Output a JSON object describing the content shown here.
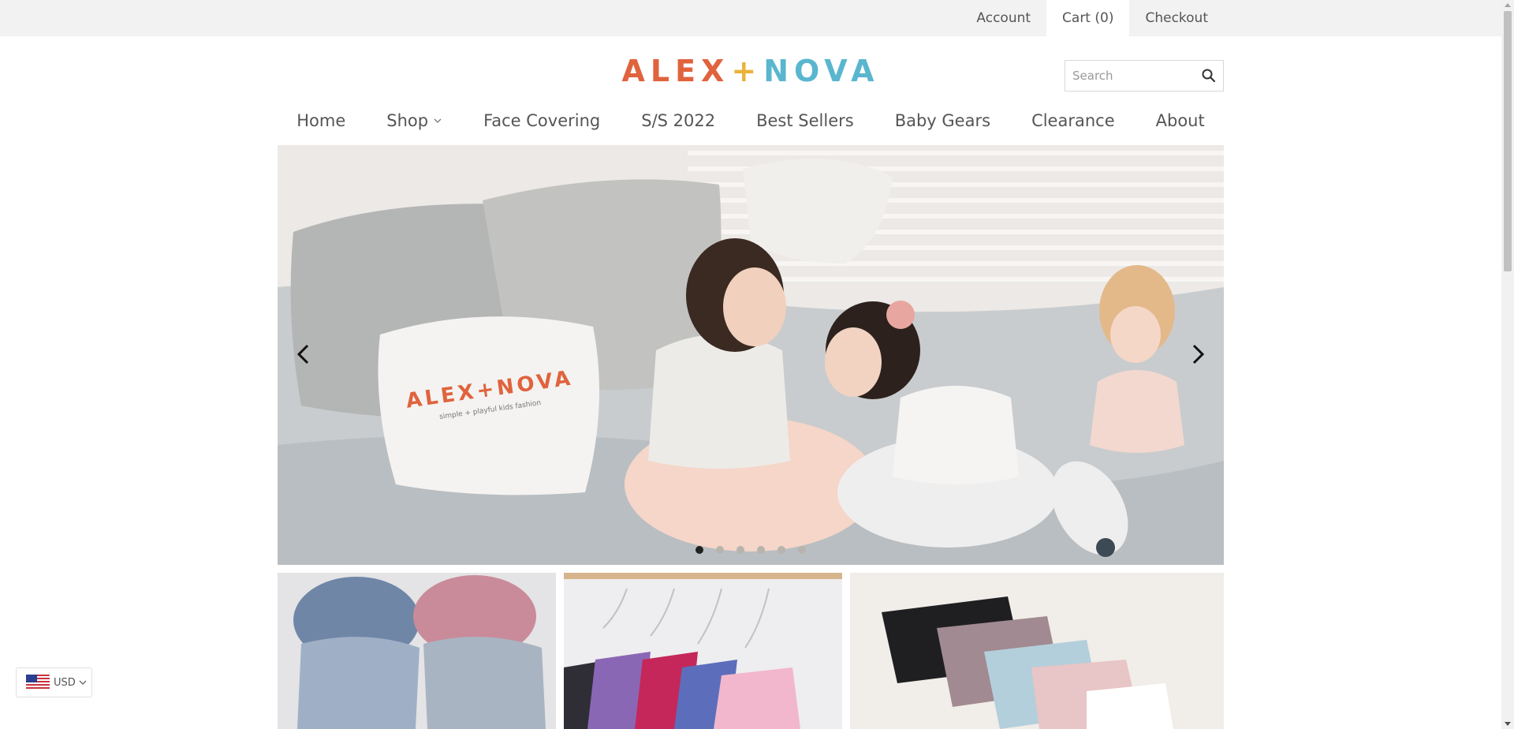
{
  "topbar": {
    "account": "Account",
    "cart": "Cart (0)",
    "checkout": "Checkout"
  },
  "logo": {
    "alex": "ALEX",
    "plus": "+",
    "nova": "NOVA"
  },
  "search": {
    "placeholder": "Search"
  },
  "nav": {
    "home": "Home",
    "shop": "Shop",
    "face_covering": "Face Covering",
    "ss2022": "S/S 2022",
    "best_sellers": "Best Sellers",
    "baby_gears": "Baby Gears",
    "clearance": "Clearance",
    "about": "About"
  },
  "hero": {
    "slide_count": 6,
    "active_slide": 1,
    "pillow_text": "ALEX+NOVA",
    "pillow_tagline": "simple + playful kids fashion"
  },
  "currency": {
    "code": "USD"
  },
  "colors": {
    "logo_orange": "#e0633d",
    "logo_yellow": "#e9b33a",
    "logo_teal": "#5ab6cf",
    "topbar_bg": "#f2f2f2"
  }
}
